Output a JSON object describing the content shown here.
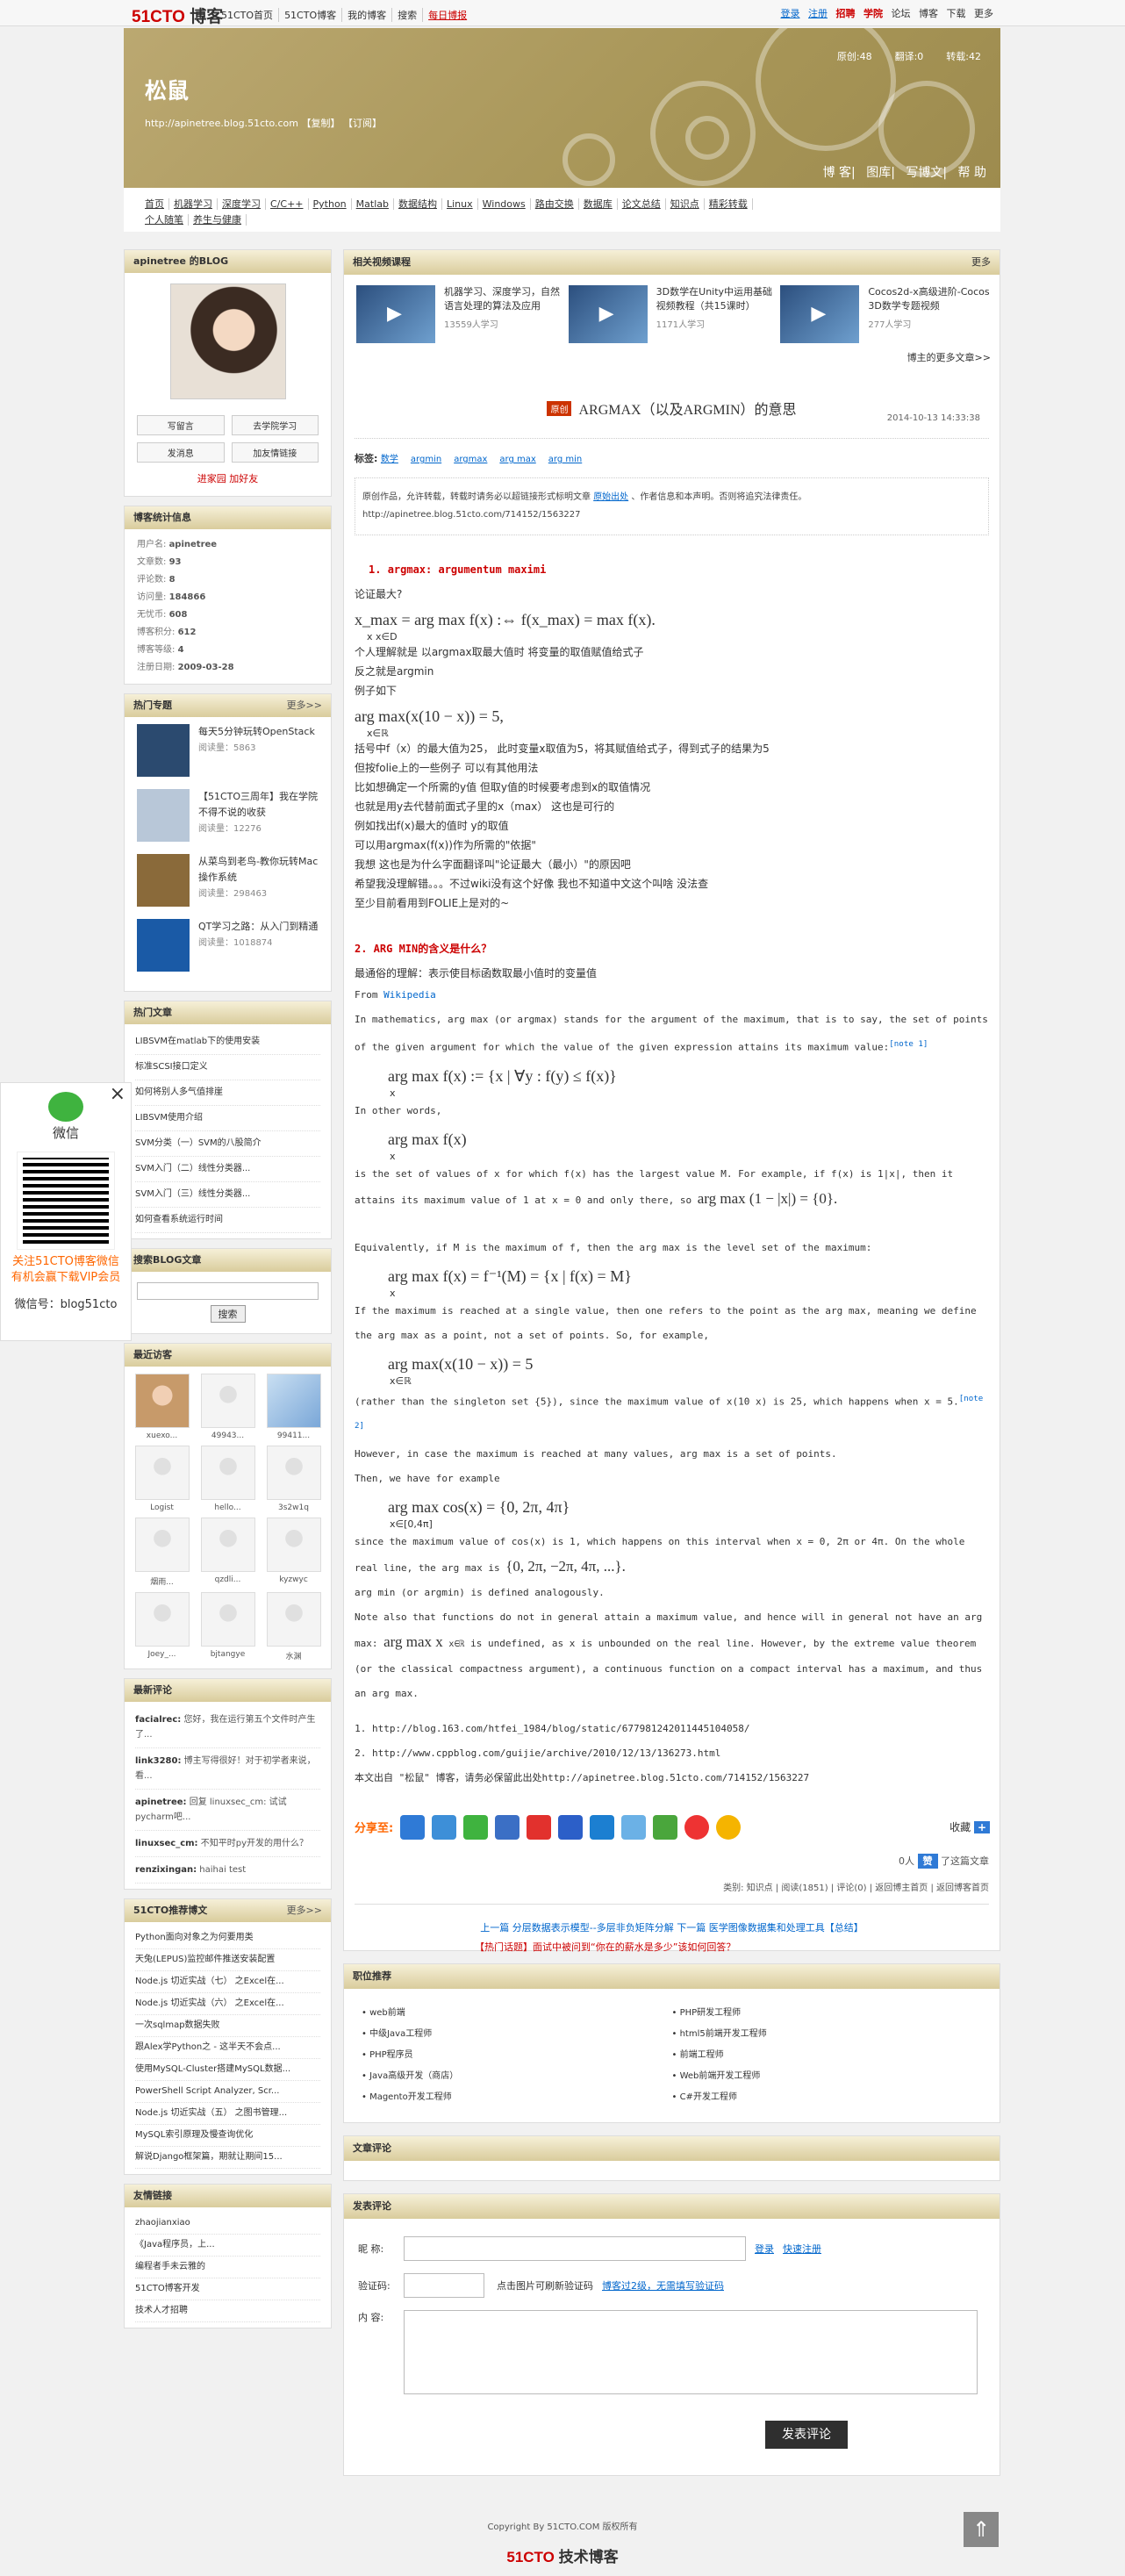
{
  "topbar": {
    "logo_main": "51CTO",
    "logo_sub": "博客",
    "nav": [
      "51CTO首页",
      "51CTO博客",
      "我的博客",
      "搜索",
      "每日博报"
    ],
    "right": [
      "登录",
      "注册",
      "招聘",
      "学院",
      "论坛",
      "博客",
      "下载",
      "更多"
    ]
  },
  "banner": {
    "name": "松鼠",
    "url": "http://apinetree.blog.51cto.com",
    "url_links": "【复制】  【订阅】",
    "stats": [
      "原创:48",
      "翻译:0",
      "转载:42"
    ],
    "nav": [
      "博 客",
      "图库",
      "写博文",
      "帮 助"
    ]
  },
  "menu": [
    "首页",
    "机器学习",
    "深度学习",
    "C/C++",
    "Python",
    "Matlab",
    "数据结构",
    "Linux",
    "Windows",
    "路由交换",
    "数据库",
    "论文总结",
    "知识点",
    "精彩转载",
    "个人随笔",
    "养生与健康"
  ],
  "sidebar": {
    "profile_title": "apinetree 的BLOG",
    "buttons": [
      "写留言",
      "去学院学习",
      "发消息",
      "加友情链接"
    ],
    "profile_foot": "进家园 加好友",
    "stats_title": "博客统计信息",
    "stats": [
      {
        "k": "用户名:",
        "v": "apinetree"
      },
      {
        "k": "文章数:",
        "v": "93"
      },
      {
        "k": "评论数:",
        "v": "8"
      },
      {
        "k": "访问量:",
        "v": "184866"
      },
      {
        "k": "无忧币:",
        "v": "608"
      },
      {
        "k": "博客积分:",
        "v": "612"
      },
      {
        "k": "博客等级:",
        "v": "4"
      },
      {
        "k": "注册日期:",
        "v": "2009-03-28"
      }
    ],
    "hot_title": "热门专题",
    "hot_more": "更多>>",
    "hot": [
      {
        "title": "每天5分钟玩转OpenStack",
        "reads": "阅读量：5863",
        "color": "#2b4a6f"
      },
      {
        "title": "【51CTO三周年】我在学院不得不说的收获",
        "reads": "阅读量：12276",
        "color": "#b8c7d8"
      },
      {
        "title": "从菜鸟到老鸟-教你玩转Mac操作系统",
        "reads": "阅读量：298463",
        "color": "#8a6a3a"
      },
      {
        "title": "QT学习之路：从入门到精通",
        "reads": "阅读量：1018874",
        "color": "#1a5aa6"
      }
    ],
    "hotart_title": "热门文章",
    "hotart": [
      "LIBSVM在matlab下的使用安装",
      "标准SCSI接口定义",
      "如何将别人多气值排崖",
      "LIBSVM使用介绍",
      "SVM分类（一）SVM的八股简介",
      "SVM入门（二）线性分类器...",
      "SVM入门（三）线性分类器...",
      "如何查看系统运行时间"
    ],
    "search_title": "搜索BLOG文章",
    "search_btn": "搜索",
    "visitors_title": "最近访客",
    "visitors": [
      "xuexo...",
      "49943...",
      "99411...",
      "Logist",
      "hello...",
      "3s2w1q",
      "烟雨...",
      "qzdli...",
      "kyzwyc",
      "Joey_...",
      "bjtangye",
      "水渊"
    ],
    "comments_title": "最新评论",
    "comments": [
      {
        "u": "facialrec:",
        "t": "您好，我在运行第五个文件时产生了..."
      },
      {
        "u": "link3280:",
        "t": "博主写得很好！对于初学者来说，看..."
      },
      {
        "u": "apinetree:",
        "t": "回复 linuxsec_cm: 试试pycharm吧..."
      },
      {
        "u": "linuxsec_cm:",
        "t": "不知平时py开发的用什么？"
      },
      {
        "u": "renzixingan:",
        "t": "haihai test"
      }
    ],
    "rec_title": "51CTO推荐博文",
    "rec_more": "更多>>",
    "rec": [
      "Python面向对象之为何要用类",
      "天兔(LEPUS)监控邮件推送安装配置",
      "Node.js 切近实战（七） 之Excel在...",
      "Node.js 切近实战（六） 之Excel在...",
      "一次sqlmap数据失败",
      "跟Alex学Python之 - 这半天不会点...",
      "使用MySQL-Cluster搭建MySQL数据...",
      "PowerShell Script Analyzer, Scr...",
      "Node.js 切近实战（五） 之图书管理...",
      "MySQL索引原理及慢查询优化",
      "解说Django框架篇，期就让期间15..."
    ],
    "links_title": "友情链接",
    "links": [
      "zhaojianxiao",
      "《Java程序员，上...",
      "编程者手未云雅的",
      "51CTO博客开发",
      "技术人才招聘"
    ]
  },
  "wechat": {
    "close": "×",
    "label": "微信",
    "t1": "关注51CTO博客微信",
    "t2": "有机会赢下载VIP会员",
    "t3": "微信号：blog51cto"
  },
  "videos": {
    "title": "相关视频课程",
    "more": "更多",
    "items": [
      {
        "t": "机器学习、深度学习，自然语言处理的算法及应用",
        "n": "13559人学习"
      },
      {
        "t": "3D数学在Unity中运用基础视频教程（共15课时）",
        "n": "1171人学习"
      },
      {
        "t": "Cocos2d-x高级进阶-Cocos 3D数学专题视频",
        "n": "277人学习"
      }
    ],
    "foot": "博主的更多文章>>"
  },
  "article": {
    "badge": "原创",
    "title": "ARGMAX（以及ARGMIN）的意思",
    "date": "2014-10-13 14:33:38",
    "tags_label": "标签:",
    "tags": [
      "数学",
      "argmin",
      "argmax",
      "arg max",
      "arg min"
    ],
    "notice1": "原创作品，允许转载，转载时请务必以超链接形式标明文章 ",
    "notice_link": "原始出处",
    "notice2": " 、作者信息和本声明。否则将追究法律责任。http://apinetree.blog.51cto.com/714152/1563227",
    "h1": "argmax: argumentum maximi",
    "l1": "论证最大?",
    "m1": "x_max = arg max f(x) :⇔ f(x_max) = max f(x).",
    "m1s": "x            x∈D",
    "l2": "个人理解就是 以argmax取最大值时 将变量的取值赋值给式子",
    "l3": "反之就是argmin",
    "l4": "例子如下",
    "m2": "arg max(x(10 − x)) = 5,",
    "m2s": "x∈ℝ",
    "l5": "括号中f（x）的最大值为25， 此时变量x取值为5，将其赋值给式子，得到式子的结果为5",
    "l6": "但按folie上的一些例子 可以有其他用法",
    "l7": "比如想确定一个所需的y值 但取y值的时候要考虑到x的取值情况",
    "l8": "也就是用y去代替前面式子里的x（max） 这也是可行的",
    "l9": "例如找出f(x)最大的值时 y的取值",
    "l10": "可以用argmax(f(x))作为所需的\"依据\"",
    "l11": "我想 这也是为什么字面翻译叫\"论证最大（最小）\"的原因吧",
    "l12": "希望我没理解错。。。不过wiki没有这个好像 我也不知道中文这个叫啥 没法查",
    "l13": "至少目前看用到FOLIE上是对的~",
    "h2": "2. ARG MIN的含义是什么？",
    "l14": "最通俗的理解：表示使目标函数取最小值时的变量值",
    "from": "From ",
    "wiki": "Wikipedia",
    "p1": "In mathematics, arg max (or argmax) stands for the argument of the maximum, that is to say, the set of points of the given argument for which the value of the given expression attains its maximum value:",
    "note1": "[note 1]",
    "m3": "arg max f(x) := {x | ∀y : f(y) ≤ f(x)}",
    "m3s": "x",
    "p2": "In other words,",
    "m4": "arg max f(x)",
    "m4s": "x",
    "p3": "is the set of values of x for which f(x) has the largest value M. For example, if f(x) is 1|x|, then it attains its maximum value of 1 at x = 0 and only there, so",
    "m5": "arg max (1 − |x|) = {0}.",
    "p4": "Equivalently, if M is the maximum of f, then the arg max is the level set of the maximum:",
    "m6": "arg max f(x) = f⁻¹(M) = {x | f(x) = M}",
    "m6s": "x",
    "p5": "If the maximum is reached at a single value, then one refers to the point as the arg max, meaning we define the arg max as a point, not a set of points. So, for example,",
    "m7": "arg max(x(10 − x)) = 5",
    "m7s": "x∈ℝ",
    "p6": "(rather than the singleton set {5}), since the maximum value of x(10  x) is 25, which happens when x = 5.",
    "note2": "[note 2]",
    "p7": "However, in case the maximum is reached at many values, arg max is a set of points.",
    "p8": "Then, we have for example",
    "m8": "arg max cos(x) = {0, 2π, 4π}",
    "m8s": "x∈[0,4π]",
    "p9": "since the maximum value of cos(x) is 1, which happens on this interval when x = 0, 2π or 4π. On the whole real line, the arg max is",
    "m9": "{0, 2π, −2π, 4π, ...}.",
    "p10": "arg min (or argmin) is defined analogously.",
    "p11": "Note also that functions do not in general attain a maximum value, and hence will in general not have an arg max:",
    "m10": "arg max x",
    "m10s": "x∈ℝ",
    "p12": "is undefined, as x is unbounded on the real line. However, by the extreme value theorem (or the classical compactness argument), a continuous function on a compact interval has a maximum, and thus an arg max.",
    "refs": [
      "http://blog.163.com/htfei_1984/blog/static/677981242011445104058/",
      "http://www.cppblog.com/guijie/archive/2010/12/13/136273.html"
    ],
    "source": "本文出自 \"松鼠\" 博客，请务必保留此出处http://apinetree.blog.51cto.com/714152/1563227",
    "share": "分享至:",
    "fav": "收藏",
    "like_count": "0人",
    "like_text": "了这篇文章",
    "cats": "类别: 知识点 | 阅读(1851) | 评论(0) |  返回博主首页 | 返回博客首页",
    "prevnext": "上一篇 分层数据表示模型--多层非负矩阵分解  下一篇 医学图像数据集和处理工具【总结】"
  },
  "jobs": {
    "title": "职位推荐",
    "items": [
      "web前端",
      "PHP研发工程师",
      "中级Java工程师",
      "html5前端开发工程师",
      "PHP程序员",
      "前端工程师",
      "Java高级开发（商店）",
      "Web前端开发工程师",
      "Magento开发工程师",
      "C#开发工程师"
    ]
  },
  "artcomments": {
    "title": "文章评论"
  },
  "comment_form": {
    "title": "发表评论",
    "hot": "【热门话题】面试中被问到“你在的薪水是多少”该如何回答？",
    "name_label": "昵  称:",
    "login": "登录",
    "register": "快速注册",
    "captcha_label": "验证码:",
    "captcha_hint": "点击图片可刷新验证码",
    "captcha_link": "博客过2级，无需填写验证码",
    "content_label": "内  容:",
    "submit": "发表评论"
  },
  "footer": {
    "copy": "Copyright By 51CTO.COM 版权所有",
    "logo_main": "51CTO",
    "logo_sub": "技术博客",
    "totop": "⇑"
  }
}
